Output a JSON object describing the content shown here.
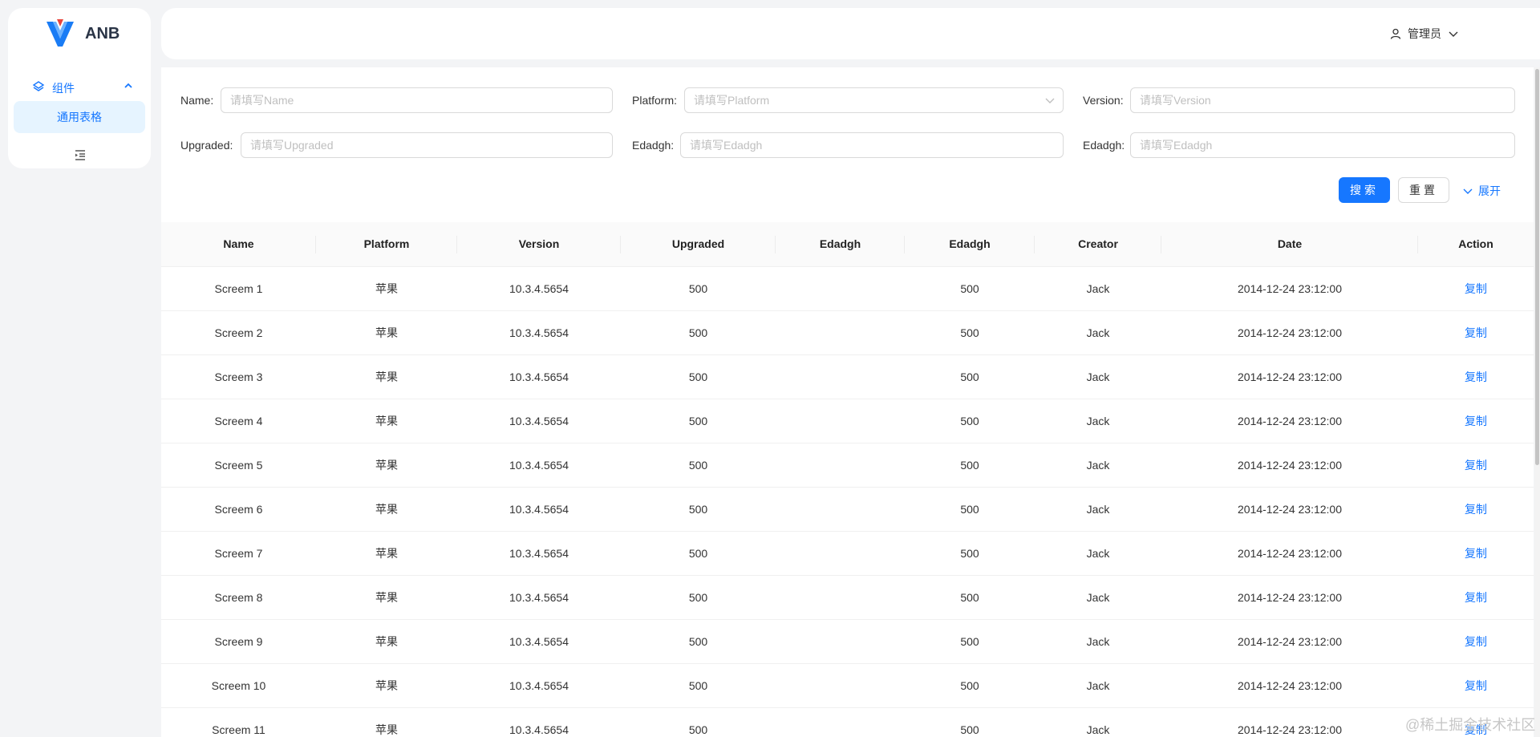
{
  "brand": {
    "name": "ANB"
  },
  "sidebar": {
    "group_label": "组件",
    "items": [
      {
        "label": "通用表格"
      }
    ]
  },
  "header": {
    "user_name": "管理员"
  },
  "search_form": {
    "fields": [
      {
        "label": "Name",
        "placeholder": "请填写Name"
      },
      {
        "label": "Platform",
        "placeholder": "请填写Platform"
      },
      {
        "label": "Version",
        "placeholder": "请填写Version"
      },
      {
        "label": "Upgraded",
        "placeholder": "请填写Upgraded"
      },
      {
        "label": "Edadgh",
        "placeholder": "请填写Edadgh"
      },
      {
        "label": "Edadgh",
        "placeholder": "请填写Edadgh"
      }
    ],
    "search_label": "搜索",
    "reset_label": "重置",
    "expand_label": "展开"
  },
  "table": {
    "columns": [
      "Name",
      "Platform",
      "Version",
      "Upgraded",
      "Edadgh",
      "Edadgh",
      "Creator",
      "Date",
      "Action"
    ],
    "rows": [
      {
        "name": "Screem 1",
        "platform": "苹果",
        "version": "10.3.4.5654",
        "upgraded": "500",
        "edadgh1": "",
        "edadgh2": "500",
        "creator": "Jack",
        "date": "2014-12-24 23:12:00",
        "action": "复制"
      },
      {
        "name": "Screem 2",
        "platform": "苹果",
        "version": "10.3.4.5654",
        "upgraded": "500",
        "edadgh1": "",
        "edadgh2": "500",
        "creator": "Jack",
        "date": "2014-12-24 23:12:00",
        "action": "复制"
      },
      {
        "name": "Screem 3",
        "platform": "苹果",
        "version": "10.3.4.5654",
        "upgraded": "500",
        "edadgh1": "",
        "edadgh2": "500",
        "creator": "Jack",
        "date": "2014-12-24 23:12:00",
        "action": "复制"
      },
      {
        "name": "Screem 4",
        "platform": "苹果",
        "version": "10.3.4.5654",
        "upgraded": "500",
        "edadgh1": "",
        "edadgh2": "500",
        "creator": "Jack",
        "date": "2014-12-24 23:12:00",
        "action": "复制"
      },
      {
        "name": "Screem 5",
        "platform": "苹果",
        "version": "10.3.4.5654",
        "upgraded": "500",
        "edadgh1": "",
        "edadgh2": "500",
        "creator": "Jack",
        "date": "2014-12-24 23:12:00",
        "action": "复制"
      },
      {
        "name": "Screem 6",
        "platform": "苹果",
        "version": "10.3.4.5654",
        "upgraded": "500",
        "edadgh1": "",
        "edadgh2": "500",
        "creator": "Jack",
        "date": "2014-12-24 23:12:00",
        "action": "复制"
      },
      {
        "name": "Screem 7",
        "platform": "苹果",
        "version": "10.3.4.5654",
        "upgraded": "500",
        "edadgh1": "",
        "edadgh2": "500",
        "creator": "Jack",
        "date": "2014-12-24 23:12:00",
        "action": "复制"
      },
      {
        "name": "Screem 8",
        "platform": "苹果",
        "version": "10.3.4.5654",
        "upgraded": "500",
        "edadgh1": "",
        "edadgh2": "500",
        "creator": "Jack",
        "date": "2014-12-24 23:12:00",
        "action": "复制"
      },
      {
        "name": "Screem 9",
        "platform": "苹果",
        "version": "10.3.4.5654",
        "upgraded": "500",
        "edadgh1": "",
        "edadgh2": "500",
        "creator": "Jack",
        "date": "2014-12-24 23:12:00",
        "action": "复制"
      },
      {
        "name": "Screem 10",
        "platform": "苹果",
        "version": "10.3.4.5654",
        "upgraded": "500",
        "edadgh1": "",
        "edadgh2": "500",
        "creator": "Jack",
        "date": "2014-12-24 23:12:00",
        "action": "复制"
      },
      {
        "name": "Screem 11",
        "platform": "苹果",
        "version": "10.3.4.5654",
        "upgraded": "500",
        "edadgh1": "",
        "edadgh2": "500",
        "creator": "Jack",
        "date": "2014-12-24 23:12:00",
        "action": "复制"
      }
    ]
  },
  "watermark": {
    "text": "@稀土掘金技术社区"
  },
  "colors": {
    "accent": "#1677ff",
    "accent_bg": "#e6f4ff",
    "page_bg": "#f3f4f6"
  }
}
